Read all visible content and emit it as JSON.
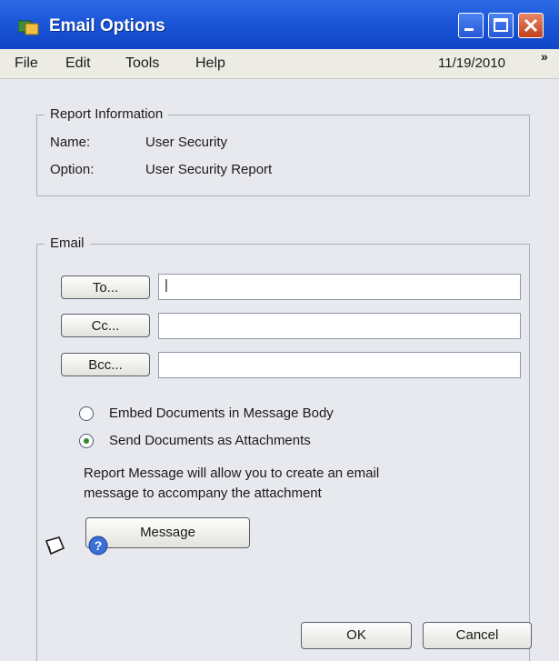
{
  "window": {
    "title": "Email Options",
    "app_icon": "window-app-icon",
    "controls": [
      "minimize-icon",
      "maximize-icon",
      "close-icon"
    ]
  },
  "menu": {
    "items": [
      "File",
      "Edit",
      "Tools",
      "Help"
    ],
    "date": "11/19/2010",
    "overflow": "»"
  },
  "report_info": {
    "legend": "Report Information",
    "name_label": "Name:",
    "name_value": "User Security",
    "option_label": "Option:",
    "option_value": "User Security Report"
  },
  "email": {
    "legend": "Email",
    "to_label": "To...",
    "to_value": "|",
    "cc_label": "Cc...",
    "cc_value": "",
    "bcc_label": "Bcc...",
    "bcc_value": "",
    "radio_embed": "Embed Documents in Message Body",
    "radio_attach": "Send Documents as Attachments",
    "selected_option": "Send Documents as Attachments",
    "message_line1": "Report Message will allow you to create an email",
    "message_line2": "message to accompany the attachment",
    "message_button": "Message"
  },
  "footer": {
    "ok_label": "OK",
    "cancel_label": "Cancel",
    "icons": [
      "note-icon",
      "help-icon"
    ]
  },
  "colors": {
    "titlebar": "#1c56d8",
    "close_button": "#c2401c",
    "dialog_background": "#e8e9ef"
  }
}
